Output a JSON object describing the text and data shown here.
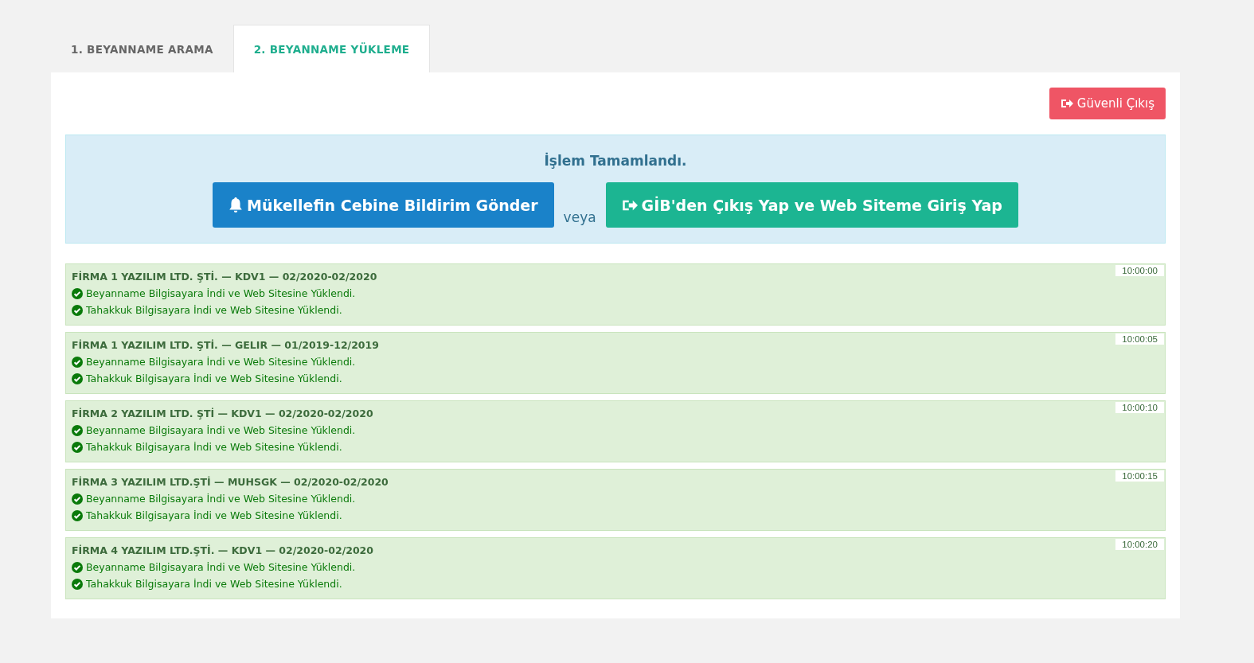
{
  "tabs": [
    {
      "label": "1. BEYANNAME ARAMA",
      "selected": false
    },
    {
      "label": "2. BEYANNAME YÜKLEME",
      "selected": true
    }
  ],
  "logout_button": "Güvenli Çıkış",
  "alert": {
    "message": "İşlem Tamamlandı.",
    "notify_button": "Mükellefin Cebine Bildirim Gönder",
    "separator": "veya",
    "exit_button": "GİB'den Çıkış Yap ve Web Siteme Giriş Yap"
  },
  "results": [
    {
      "title": "FİRMA 1 YAZILIM LTD. ŞTİ. — KDV1 — 02/2020-02/2020",
      "time": "10:00:00",
      "lines": [
        "Beyanname Bilgisayara İndi ve Web Sitesine Yüklendi.",
        "Tahakkuk Bilgisayara İndi ve Web Sitesine Yüklendi."
      ]
    },
    {
      "title": "FİRMA 1 YAZILIM LTD. ŞTİ. — GELIR — 01/2019-12/2019",
      "time": "10:00:05",
      "lines": [
        "Beyanname Bilgisayara İndi ve Web Sitesine Yüklendi.",
        "Tahakkuk Bilgisayara İndi ve Web Sitesine Yüklendi."
      ]
    },
    {
      "title": "FİRMA 2 YAZILIM LTD. ŞTİ — KDV1 — 02/2020-02/2020",
      "time": "10:00:10",
      "lines": [
        "Beyanname Bilgisayara İndi ve Web Sitesine Yüklendi.",
        "Tahakkuk Bilgisayara İndi ve Web Sitesine Yüklendi."
      ]
    },
    {
      "title": "FİRMA 3 YAZILIM LTD.ŞTİ — MUHSGK — 02/2020-02/2020",
      "time": "10:00:15",
      "lines": [
        "Beyanname Bilgisayara İndi ve Web Sitesine Yüklendi.",
        "Tahakkuk Bilgisayara İndi ve Web Sitesine Yüklendi."
      ]
    },
    {
      "title": "FİRMA 4 YAZILIM LTD.ŞTİ. — KDV1 — 02/2020-02/2020",
      "time": "10:00:20",
      "lines": [
        "Beyanname Bilgisayara İndi ve Web Sitesine Yüklendi.",
        "Tahakkuk Bilgisayara İndi ve Web Sitesine Yüklendi."
      ]
    }
  ]
}
